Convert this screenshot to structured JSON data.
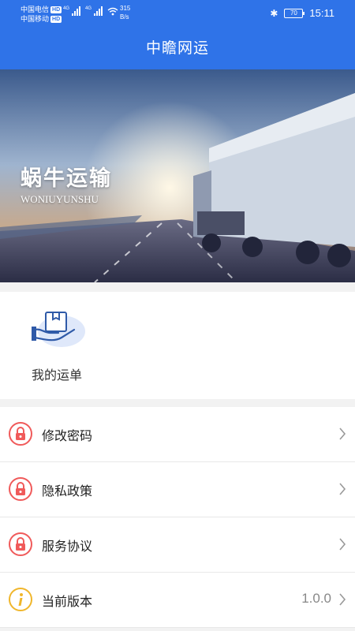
{
  "status_bar": {
    "carrier1": "中国电信",
    "carrier2": "中国移动",
    "hd": "HD",
    "net": "4G",
    "speed_value": "315",
    "speed_unit": "B/s",
    "battery": "70",
    "time": "15:11"
  },
  "header": {
    "title": "中瞻网运"
  },
  "banner": {
    "title_cn": "蜗牛运输",
    "title_en": "WONIUYUNSHU"
  },
  "orders": {
    "label": "我的运单"
  },
  "menu": {
    "items": [
      {
        "label": "修改密码",
        "icon": "lock-icon"
      },
      {
        "label": "隐私政策",
        "icon": "lock-icon"
      },
      {
        "label": "服务协议",
        "icon": "lock-icon"
      },
      {
        "label": "当前版本",
        "icon": "info-icon",
        "value": "1.0.0"
      }
    ]
  },
  "colors": {
    "brand_blue": "#2f73e8",
    "lock_red": "#f05a5a",
    "info_yellow": "#f0b62b"
  }
}
